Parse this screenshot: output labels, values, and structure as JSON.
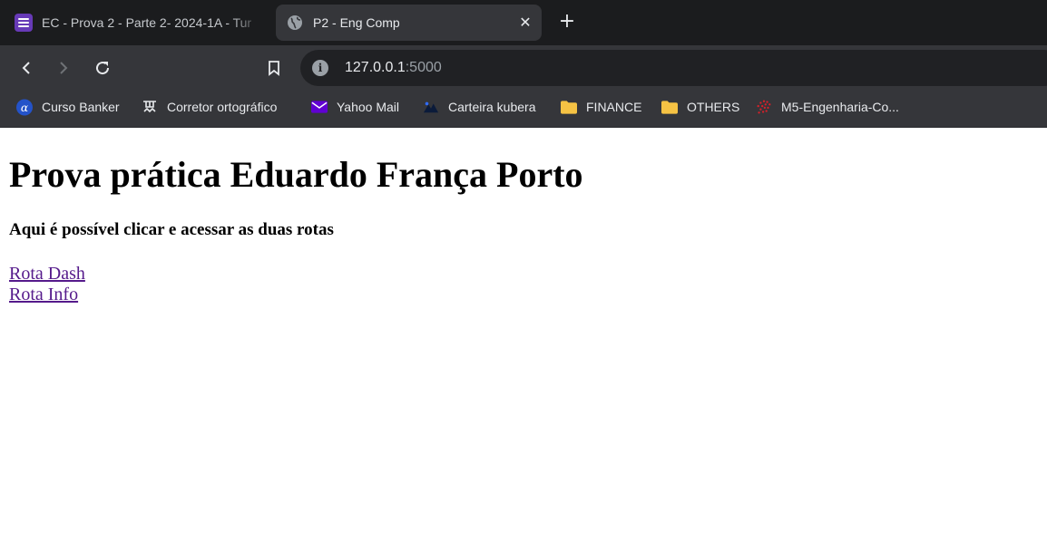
{
  "browser": {
    "tabs": [
      {
        "title": "EC - Prova 2 - Parte 2- 2024-1A - Tur",
        "active": false,
        "favicon": "google-forms-list-icon"
      },
      {
        "title": "P2 - Eng Comp",
        "active": true,
        "favicon": "globe-icon"
      }
    ],
    "new_tab_label": "+",
    "close_label": "✕",
    "address": {
      "host": "127.0.0.1",
      "port": ":5000"
    },
    "bookmarks": [
      {
        "label": "Curso Banker",
        "icon": "alpha-logo-icon"
      },
      {
        "label": "Corretor ortográfico",
        "icon": "spellcheck-icon"
      },
      {
        "label": "Yahoo Mail",
        "icon": "mail-envelope-icon"
      },
      {
        "label": "Carteira kubera",
        "icon": "kubera-icon"
      },
      {
        "label": "FINANCE",
        "icon": "folder-icon"
      },
      {
        "label": "OTHERS",
        "icon": "folder-icon"
      },
      {
        "label": "M5-Engenharia-Co...",
        "icon": "dotted-logo-icon"
      }
    ],
    "colors": {
      "tabstrip": "#1b1c1e",
      "toolbar": "#35363a",
      "omnibox": "#202124",
      "forms_purple": "#673ab7",
      "folder_yellow": "#f6c344",
      "visited_link": "#551a8b"
    }
  },
  "page": {
    "heading": "Prova prática Eduardo França Porto",
    "subheading": "Aqui é possível clicar e acessar as duas rotas",
    "links": [
      {
        "label": "Rota Dash"
      },
      {
        "label": "Rota Info"
      }
    ]
  }
}
